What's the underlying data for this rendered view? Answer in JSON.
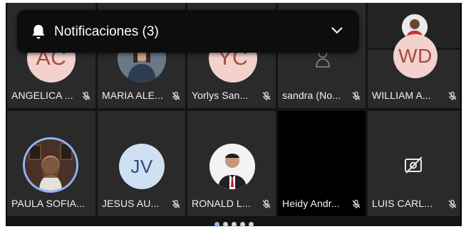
{
  "notification": {
    "label": "Notificaciones (3)",
    "bell_icon": "bell-icon",
    "expand_icon": "chevron-down-icon"
  },
  "participants_row1": [
    {
      "name": "ANGELICA ...",
      "initials": "AC",
      "muted": true
    },
    {
      "name": "MARIA ALE...",
      "initials": "",
      "muted": true
    },
    {
      "name": "Yorlys San...",
      "initials": "YC",
      "muted": true
    },
    {
      "name": "sandra (No...",
      "initials": "",
      "muted": true
    },
    {
      "name": "WILLIAM A...",
      "initials": "WD",
      "muted": true
    }
  ],
  "participants_row2": [
    {
      "name": "PAULA SOFIA...",
      "initials": "",
      "muted": false,
      "speaking": true
    },
    {
      "name": "JESUS AU...",
      "initials": "JV",
      "muted": true
    },
    {
      "name": "RONALD L...",
      "initials": "",
      "muted": true
    },
    {
      "name": "Heidy Andr...",
      "initials": "",
      "muted": true
    },
    {
      "name": "LUIS CARL...",
      "initials": "",
      "muted": true,
      "video_off": true
    }
  ],
  "pager": {
    "pages": 5,
    "active": 1
  },
  "colors": {
    "accent": "#8fb5ff",
    "tile": "#2a2a2a",
    "background": "#141414"
  }
}
